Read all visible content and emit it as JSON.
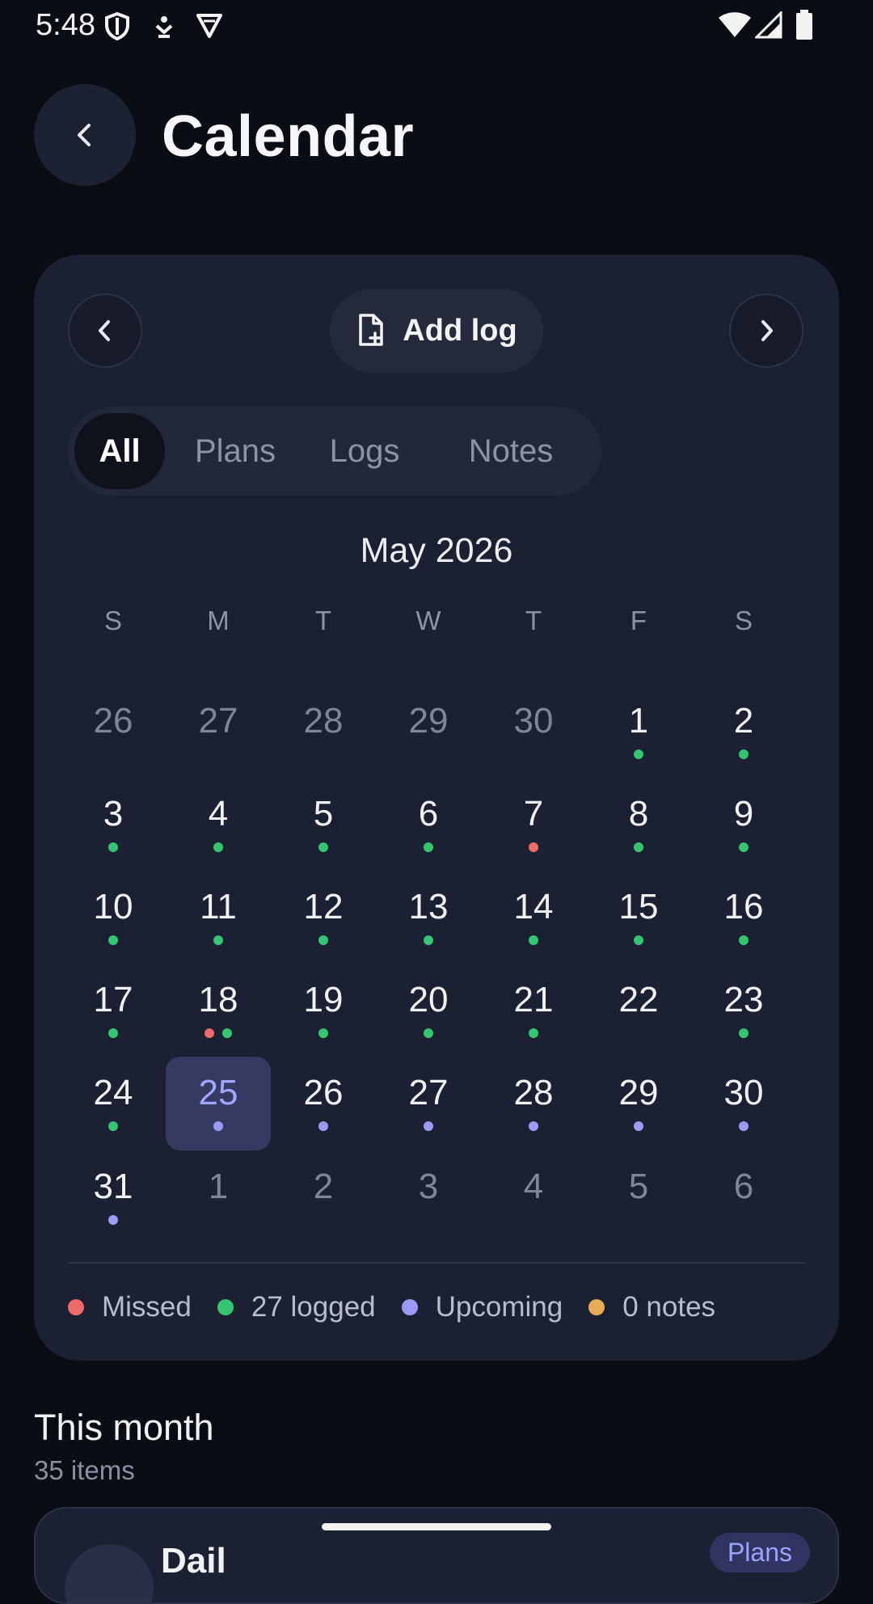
{
  "status_bar": {
    "time": "5:48",
    "left_icons": [
      "shield-icon",
      "notification-icon",
      "vpn-icon"
    ],
    "right_icons": [
      "wifi-icon",
      "signal-icon",
      "battery-icon"
    ]
  },
  "header": {
    "title": "Calendar",
    "back_icon": "chevron-left-icon"
  },
  "toolbar": {
    "add_log_label": "Add log",
    "add_log_icon": "file-plus-icon"
  },
  "tabs": [
    {
      "label": "All",
      "active": true
    },
    {
      "label": "Plans",
      "active": false
    },
    {
      "label": "Logs",
      "active": false
    },
    {
      "label": "Notes",
      "active": false
    }
  ],
  "calendar": {
    "month_label": "May 2026",
    "weekdays": [
      "S",
      "M",
      "T",
      "W",
      "T",
      "F",
      "S"
    ],
    "weeks": [
      [
        {
          "d": "26",
          "o": true
        },
        {
          "d": "27",
          "o": true
        },
        {
          "d": "28",
          "o": true
        },
        {
          "d": "29",
          "o": true
        },
        {
          "d": "30",
          "o": true
        },
        {
          "d": "1",
          "dots": [
            "logged"
          ]
        },
        {
          "d": "2",
          "dots": [
            "logged"
          ]
        }
      ],
      [
        {
          "d": "3",
          "dots": [
            "logged"
          ]
        },
        {
          "d": "4",
          "dots": [
            "logged"
          ]
        },
        {
          "d": "5",
          "dots": [
            "logged"
          ]
        },
        {
          "d": "6",
          "dots": [
            "logged"
          ]
        },
        {
          "d": "7",
          "dots": [
            "missed"
          ]
        },
        {
          "d": "8",
          "dots": [
            "logged"
          ]
        },
        {
          "d": "9",
          "dots": [
            "logged"
          ]
        }
      ],
      [
        {
          "d": "10",
          "dots": [
            "logged"
          ]
        },
        {
          "d": "11",
          "dots": [
            "logged"
          ]
        },
        {
          "d": "12",
          "dots": [
            "logged"
          ]
        },
        {
          "d": "13",
          "dots": [
            "logged"
          ]
        },
        {
          "d": "14",
          "dots": [
            "logged"
          ]
        },
        {
          "d": "15",
          "dots": [
            "logged"
          ]
        },
        {
          "d": "16",
          "dots": [
            "logged"
          ]
        }
      ],
      [
        {
          "d": "17",
          "dots": [
            "logged"
          ]
        },
        {
          "d": "18",
          "dots": [
            "missed",
            "logged"
          ]
        },
        {
          "d": "19",
          "dots": [
            "logged"
          ]
        },
        {
          "d": "20",
          "dots": [
            "logged"
          ]
        },
        {
          "d": "21",
          "dots": [
            "logged"
          ]
        },
        {
          "d": "22"
        },
        {
          "d": "23",
          "dots": [
            "logged"
          ]
        }
      ],
      [
        {
          "d": "24",
          "dots": [
            "logged"
          ]
        },
        {
          "d": "25",
          "today": true,
          "dots": [
            "upcoming"
          ]
        },
        {
          "d": "26",
          "dots": [
            "upcoming"
          ]
        },
        {
          "d": "27",
          "dots": [
            "upcoming"
          ]
        },
        {
          "d": "28",
          "dots": [
            "upcoming"
          ]
        },
        {
          "d": "29",
          "dots": [
            "upcoming"
          ]
        },
        {
          "d": "30",
          "dots": [
            "upcoming"
          ]
        }
      ],
      [
        {
          "d": "31",
          "dots": [
            "upcoming"
          ]
        },
        {
          "d": "1",
          "o": true
        },
        {
          "d": "2",
          "o": true
        },
        {
          "d": "3",
          "o": true
        },
        {
          "d": "4",
          "o": true
        },
        {
          "d": "5",
          "o": true
        },
        {
          "d": "6",
          "o": true
        }
      ]
    ]
  },
  "legend": [
    {
      "key": "missed",
      "label": "Missed"
    },
    {
      "key": "logged",
      "label": "27 logged"
    },
    {
      "key": "upcoming",
      "label": "Upcoming"
    },
    {
      "key": "notes",
      "label": "0 notes"
    }
  ],
  "colors": {
    "missed": "#f06a6a",
    "logged": "#35c46f",
    "upcoming": "#9a9cf8",
    "notes": "#e6ad55"
  },
  "section": {
    "title": "This month",
    "subtitle": "35 items"
  },
  "list_preview": {
    "title": "Dail",
    "badge": "Plans"
  }
}
